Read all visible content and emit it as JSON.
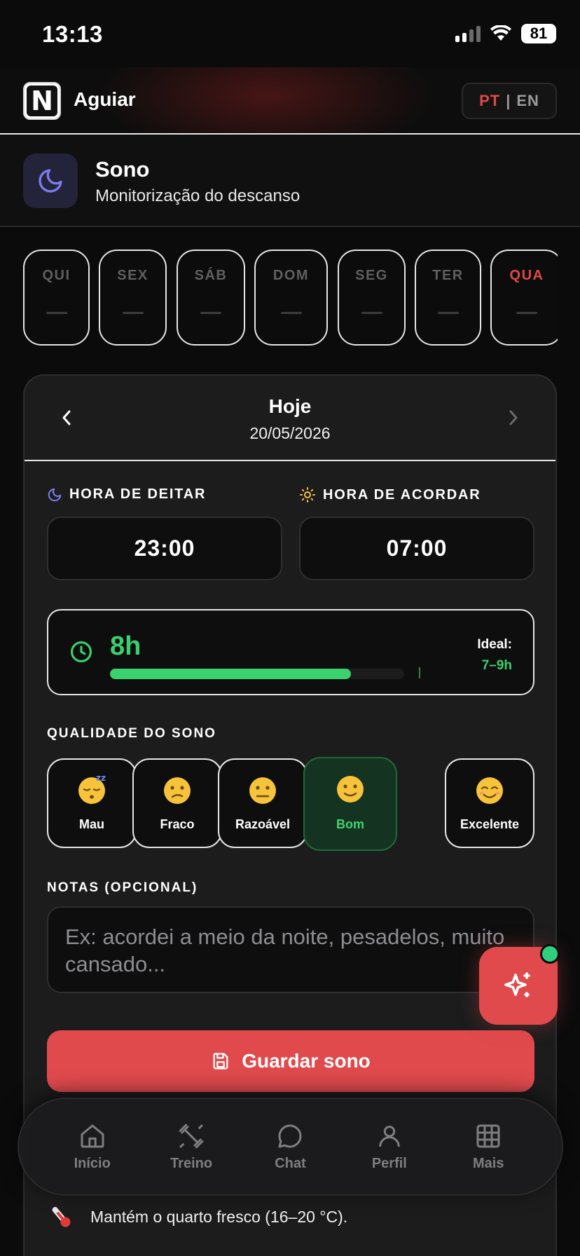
{
  "status": {
    "time": "13:13",
    "battery": "81"
  },
  "header": {
    "app_name": "Aguiar",
    "logo_letter": "N",
    "lang_pt": "PT",
    "lang_sep": "|",
    "lang_en": "EN"
  },
  "section": {
    "title": "Sono",
    "subtitle": "Monitorização do descanso"
  },
  "days": [
    {
      "label": "QUI",
      "value": "—"
    },
    {
      "label": "SEX",
      "value": "—"
    },
    {
      "label": "SÁB",
      "value": "—"
    },
    {
      "label": "DOM",
      "value": "—"
    },
    {
      "label": "SEG",
      "value": "—"
    },
    {
      "label": "TER",
      "value": "—"
    },
    {
      "label": "QUA",
      "value": "—",
      "active": true
    }
  ],
  "date_nav": {
    "title": "Hoje",
    "date": "20/05/2026"
  },
  "bedtime": {
    "label": "HORA DE DEITAR",
    "value": "23:00"
  },
  "wake": {
    "label": "HORA DE ACORDAR",
    "value": "07:00"
  },
  "duration": {
    "value": "8h",
    "ideal_label": "Ideal:",
    "ideal_value": "7–9h",
    "fill_fraction": 0.82
  },
  "quality": {
    "label": "QUALIDADE DO SONO",
    "options": [
      {
        "emoji": "😴",
        "label": "Mau"
      },
      {
        "emoji": "😕",
        "label": "Fraco"
      },
      {
        "emoji": "😐",
        "label": "Razoável"
      },
      {
        "emoji": "🙂",
        "label": "Bom",
        "selected": true
      },
      {
        "emoji": "😊",
        "label": "Excelente"
      }
    ]
  },
  "notes": {
    "label": "NOTAS (OPCIONAL)",
    "placeholder": "Ex: acordei a meio da noite, pesadelos, muito cansado..."
  },
  "save_button": "Guardar sono",
  "tip": {
    "icon": "🌡️",
    "text": "Mantém o quarto fresco (16–20 °C)."
  },
  "tabs": [
    {
      "label": "Início",
      "icon": "home-icon"
    },
    {
      "label": "Treino",
      "icon": "dumbbell-icon"
    },
    {
      "label": "Chat",
      "icon": "chat-bubble-icon"
    },
    {
      "label": "Perfil",
      "icon": "user-icon"
    },
    {
      "label": "Mais",
      "icon": "grid-icon"
    }
  ],
  "colors": {
    "accent_red": "#e04a4d",
    "accent_green": "#3bcf6e",
    "moon_blue": "#7c7cf0"
  }
}
